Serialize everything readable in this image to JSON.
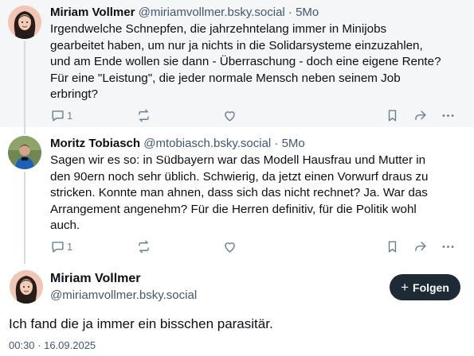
{
  "thread": [
    {
      "author_name": "Miriam Vollmer",
      "author_handle": "@miriamvollmer.bsky.social",
      "separator": "·",
      "time": "5Mo",
      "text_lines": [
        "Irgendwelche Schnepfen, die jahrzehntelang immer in Minijobs",
        "gearbeitet haben, um nur ja nichts in die Solidarsysteme einzuzahlen,",
        "und am Ende wollen sie dann - Überraschung - doch eine eigene Rente?",
        "Für eine \"Leistung\", die jeder normale Mensch neben seinem Job",
        "erbringt?"
      ],
      "reply_count": "1",
      "avatar_icon": "avatar-woman-icon"
    },
    {
      "author_name": "Moritz Tobiasch",
      "author_handle": "@mtobiasch.bsky.social",
      "separator": "·",
      "time": "5Mo",
      "text_lines": [
        "Sagen wir es so: in Südbayern war das Modell Hausfrau und Mutter in",
        "den 90ern noch sehr üblich. Schwierig, da jetzt einen Vorwurf draus zu",
        "stricken. Konnte man ahnen, dass sich das nicht rechnet? Ja. War das",
        "Arrangement angenehm? Für die Herren definitiv, für die Politik wohl",
        "auch."
      ],
      "reply_count": "1",
      "avatar_icon": "avatar-man-icon"
    }
  ],
  "main_post": {
    "author_name": "Miriam Vollmer",
    "author_handle": "@miriamvollmer.bsky.social",
    "follow_label": "Folgen",
    "follow_icon": "plus-icon",
    "text": "Ich fand die ja immer ein bisschen parasitär.",
    "timestamp": "00:30 · 16.09.2025"
  },
  "action_icons": [
    "reply-icon",
    "repost-icon",
    "like-icon",
    "bookmark-icon",
    "share-icon",
    "more-icon"
  ],
  "colors": {
    "highlight_bg": "#f4f6f8",
    "secondary_text": "#42576c",
    "icon": "#6b7f94",
    "follow_button": "#1f2a37"
  }
}
